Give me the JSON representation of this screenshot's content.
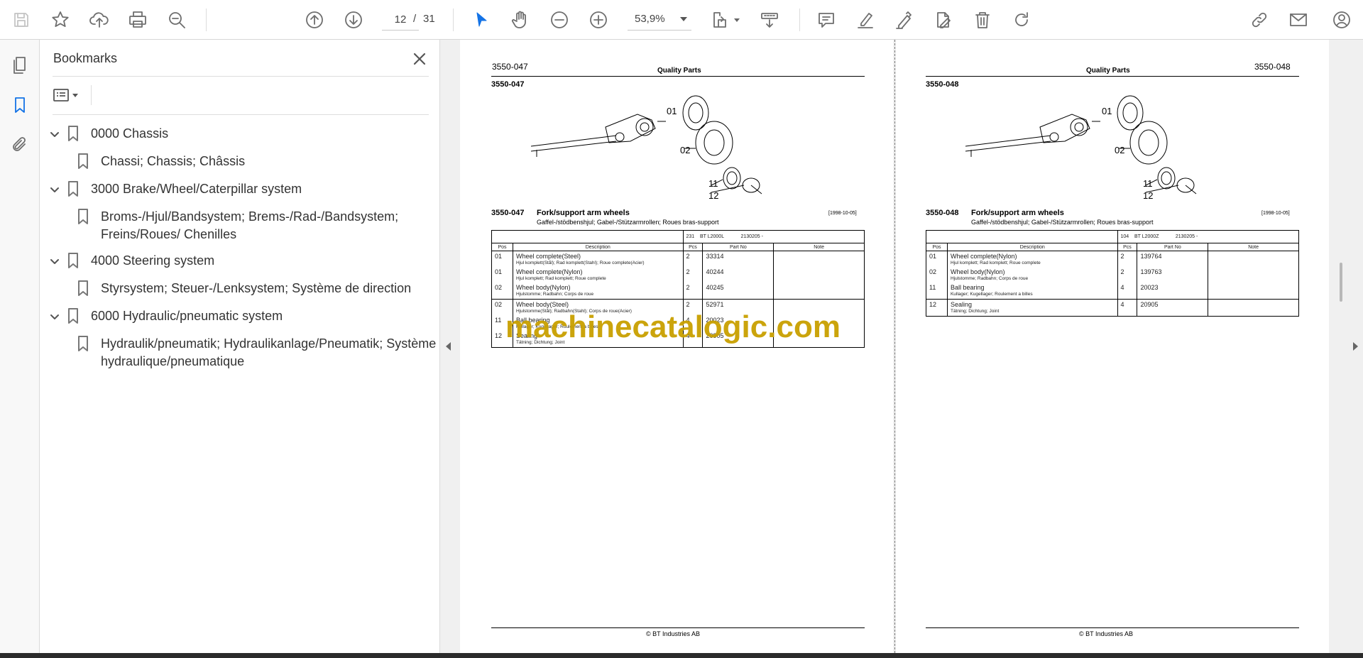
{
  "toolbar": {
    "page_current": "12",
    "page_separator": "/",
    "page_total": "31",
    "zoom": "53,9%",
    "icons": [
      "save-icon",
      "bookmark-star-icon",
      "upload-icon",
      "print-icon",
      "zoom-search-icon",
      "arrow-up-icon",
      "arrow-down-icon",
      "cursor-select-icon",
      "hand-icon",
      "zoom-out-icon",
      "zoom-in-icon",
      "fit-page-icon",
      "scroll-mode-icon",
      "comment-icon",
      "highlight-icon",
      "sign-icon",
      "edit-icon",
      "delete-icon",
      "rotate-icon",
      "share-link-icon",
      "mail-icon",
      "account-icon"
    ]
  },
  "sidebar": {
    "title": "Bookmarks",
    "items": [
      {
        "label": "0000 Chassis",
        "level": 0,
        "expanded": true
      },
      {
        "label": "Chassi; Chassis; Châssis",
        "level": 1
      },
      {
        "label": "3000 Brake/Wheel/Caterpillar system",
        "level": 0,
        "expanded": true
      },
      {
        "label": "Broms-/Hjul/Bandsystem; Brems-/Rad-/Bandsystem;",
        "label2": "Freins/Roues/ Chenilles",
        "level": 1
      },
      {
        "label": "4000 Steering system",
        "level": 0,
        "expanded": true
      },
      {
        "label": "Styrsystem; Steuer-/Lenksystem; Système de direction",
        "level": 1
      },
      {
        "label": "6000 Hydraulic/pneumatic system",
        "level": 0,
        "expanded": true
      },
      {
        "label": "Hydraulik/pneumatik; Hydraulikanlage/Pneumatik; Système",
        "label2": "hydraulique/pneumatique",
        "level": 1
      }
    ]
  },
  "pages": [
    {
      "page_number": "3550-047",
      "header": "Quality Parts",
      "drawing_code": "3550-047",
      "callouts": [
        "01",
        "02",
        "11",
        "12"
      ],
      "section_code": "3550-047",
      "section_title": "Fork/support arm wheels",
      "subtitle": "Gaffel-/stödbenshjul; Gabel-/Stützarmrollen; Roues bras-support",
      "date": "[1998-10-05]",
      "table_hdr": {
        "num": "231",
        "model": "BT L2000L",
        "serial": "2130205 -"
      },
      "columns": {
        "pos": "Pos",
        "desc": "Description",
        "pcs": "Pcs",
        "part": "Part No",
        "note": "Note"
      },
      "groups": [
        [
          {
            "pos": "01",
            "desc": "Wheel complete(Steel)",
            "trans": "Hjul komplett(Stål); Rad komplett(Stahl); Roue complete(Acier)",
            "pcs": "2",
            "part": "33314"
          },
          {
            "pos": "01",
            "desc": "Wheel complete(Nylon)",
            "trans": "Hjul komplett; Rad komplett; Roue complete",
            "pcs": "2",
            "part": "40244"
          },
          {
            "pos": "02",
            "desc": "Wheel body(Nylon)",
            "trans": "Hjulstomme; Radbahn; Corps de roue",
            "pcs": "2",
            "part": "40245"
          }
        ],
        [
          {
            "pos": "02",
            "desc": "Wheel body(Steel)",
            "trans": "Hjulstomme(Stål); Radbahn(Stahl); Corps de roue(Acier)",
            "pcs": "2",
            "part": "52971"
          },
          {
            "pos": "11",
            "desc": "Ball bearing",
            "trans": "Kullager; Kugellager; Roulement a billes",
            "pcs": "4",
            "part": "20023"
          },
          {
            "pos": "12",
            "desc": "Sealing",
            "trans": "Tätning; Dichtung; Joint",
            "pcs": "4",
            "part": "20905"
          }
        ]
      ],
      "footer": "© BT Industries AB"
    },
    {
      "page_number": "3550-048",
      "header": "Quality Parts",
      "drawing_code": "3550-048",
      "callouts": [
        "01",
        "02",
        "11",
        "12"
      ],
      "section_code": "3550-048",
      "section_title": "Fork/support arm wheels",
      "subtitle": "Gaffel-/stödbenshjul; Gabel-/Stützarmrollen; Roues bras-support",
      "date": "[1998-10-05]",
      "table_hdr": {
        "num": "104",
        "model": "BT L2000Z",
        "serial": "2130205 -"
      },
      "columns": {
        "pos": "Pos",
        "desc": "Description",
        "pcs": "Pcs",
        "part": "Part No",
        "note": "Note"
      },
      "groups": [
        [
          {
            "pos": "01",
            "desc": "Wheel complete(Nylon)",
            "trans": "Hjul komplett; Rad komplett; Roue complete",
            "pcs": "2",
            "part": "139764"
          },
          {
            "pos": "02",
            "desc": "Wheel body(Nylon)",
            "trans": "Hjulstomme; Radbahn; Corps de roue",
            "pcs": "2",
            "part": "139763"
          },
          {
            "pos": "11",
            "desc": "Ball bearing",
            "trans": "Kullager; Kugellager; Roulement a billes",
            "pcs": "4",
            "part": "20023"
          }
        ],
        [
          {
            "pos": "12",
            "desc": "Sealing",
            "trans": "Tätning; Dichtung; Joint",
            "pcs": "4",
            "part": "20905"
          }
        ]
      ],
      "footer": "© BT Industries AB"
    }
  ],
  "watermark": "machinecatalogic.com",
  "colors": {
    "accent": "#1473e6",
    "watermark": "#c9a000"
  }
}
